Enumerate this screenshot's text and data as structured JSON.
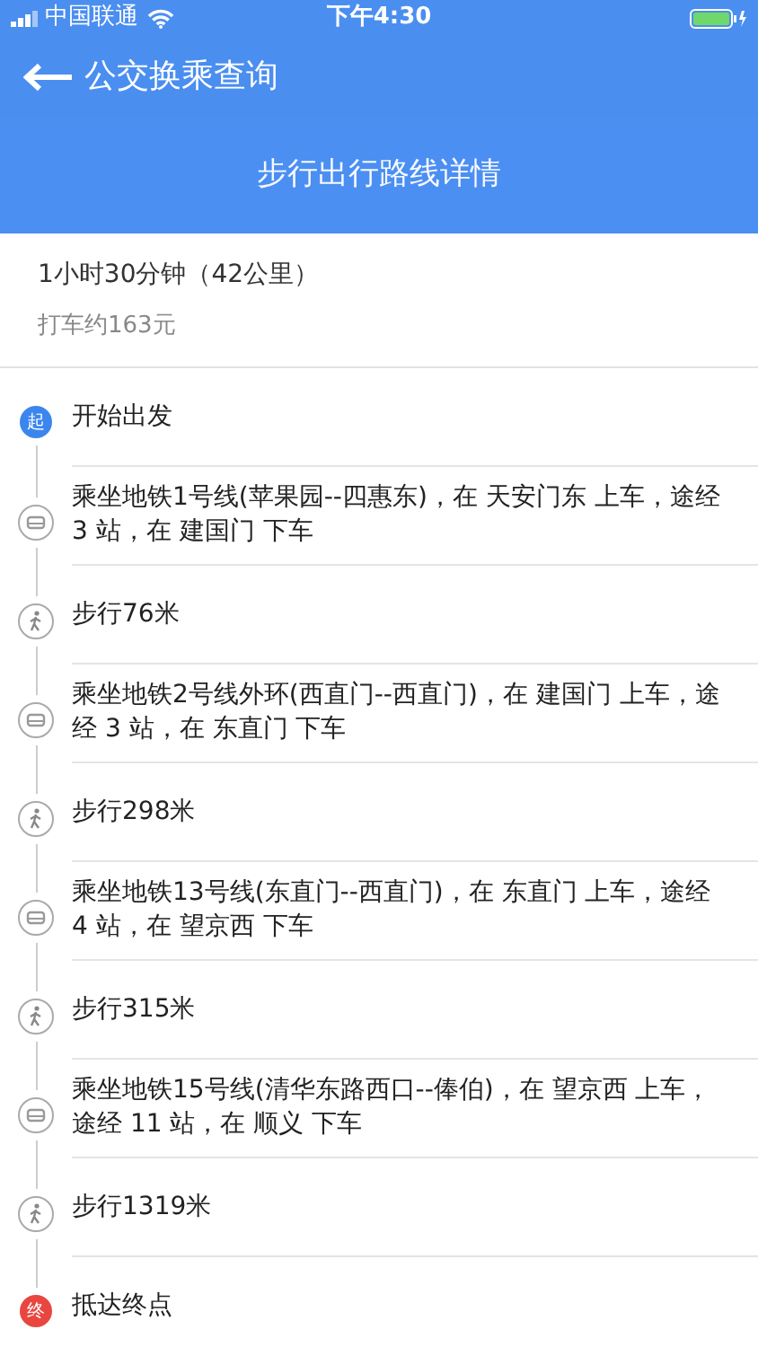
{
  "status_bar": {
    "carrier": "中国联通",
    "time": "下午4:30"
  },
  "nav_bar": {
    "back_label": "公交换乘查询"
  },
  "header": {
    "title": "步行出行路线详情"
  },
  "summary": {
    "duration": "1小时30分钟（42公里）",
    "taxi": "打车约163元"
  },
  "steps": [
    {
      "kind": "start",
      "badge": "起",
      "text": "开始出发"
    },
    {
      "kind": "subway",
      "text": "乘坐地铁1号线(苹果园--四惠东)，在 天安门东 上车，途经 3 站，在 建国门 下车"
    },
    {
      "kind": "walk",
      "text": "步行76米"
    },
    {
      "kind": "subway",
      "text": "乘坐地铁2号线外环(西直门--西直门)，在 建国门 上车，途经 3 站，在 东直门 下车"
    },
    {
      "kind": "walk",
      "text": "步行298米"
    },
    {
      "kind": "subway",
      "text": "乘坐地铁13号线(东直门--西直门)，在 东直门 上车，途经 4 站，在 望京西 下车"
    },
    {
      "kind": "walk",
      "text": "步行315米"
    },
    {
      "kind": "subway",
      "text": "乘坐地铁15号线(清华东路西口--俸伯)，在 望京西 上车，途经 11 站，在 顺义 下车"
    },
    {
      "kind": "walk",
      "text": "步行1319米"
    },
    {
      "kind": "end",
      "badge": "终",
      "text": "抵达终点"
    }
  ]
}
